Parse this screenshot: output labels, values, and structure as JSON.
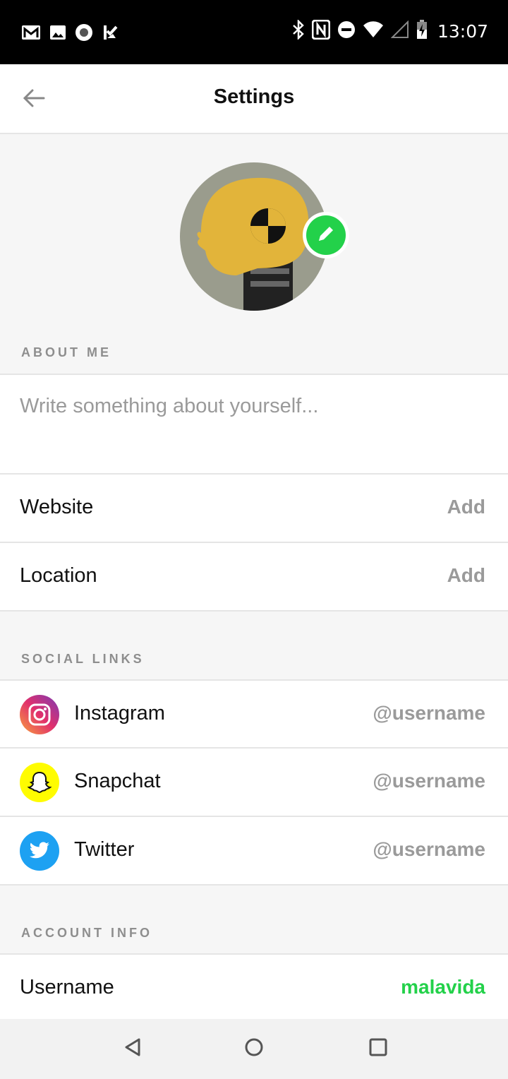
{
  "status_bar": {
    "time": "13:07",
    "left_icons": [
      "gmail-icon",
      "image-icon",
      "record-icon",
      "check-flag-icon"
    ],
    "right_icons": [
      "bluetooth-icon",
      "nfc-icon",
      "dnd-icon",
      "wifi-icon",
      "signal-icon",
      "battery-charging-icon"
    ]
  },
  "app_bar": {
    "title": "Settings",
    "back_icon": "arrow-left-icon"
  },
  "profile": {
    "avatar_icon": "crash-test-dummy-avatar",
    "edit_icon": "pencil-icon",
    "accent_color": "#23d14a"
  },
  "about_me": {
    "header": "ABOUT ME",
    "placeholder": "Write something about yourself..."
  },
  "details": {
    "website_label": "Website",
    "website_value": "Add",
    "location_label": "Location",
    "location_value": "Add"
  },
  "social_links": {
    "header": "SOCIAL LINKS",
    "items": [
      {
        "label": "Instagram",
        "value": "@username",
        "icon": "instagram-icon"
      },
      {
        "label": "Snapchat",
        "value": "@username",
        "icon": "snapchat-icon"
      },
      {
        "label": "Twitter",
        "value": "@username",
        "icon": "twitter-icon"
      }
    ]
  },
  "account_info": {
    "header": "ACCOUNT INFO",
    "username_label": "Username",
    "username_value": "malavida"
  },
  "nav_bar": {
    "icons": [
      "back-triangle-icon",
      "home-circle-icon",
      "recents-square-icon"
    ]
  }
}
